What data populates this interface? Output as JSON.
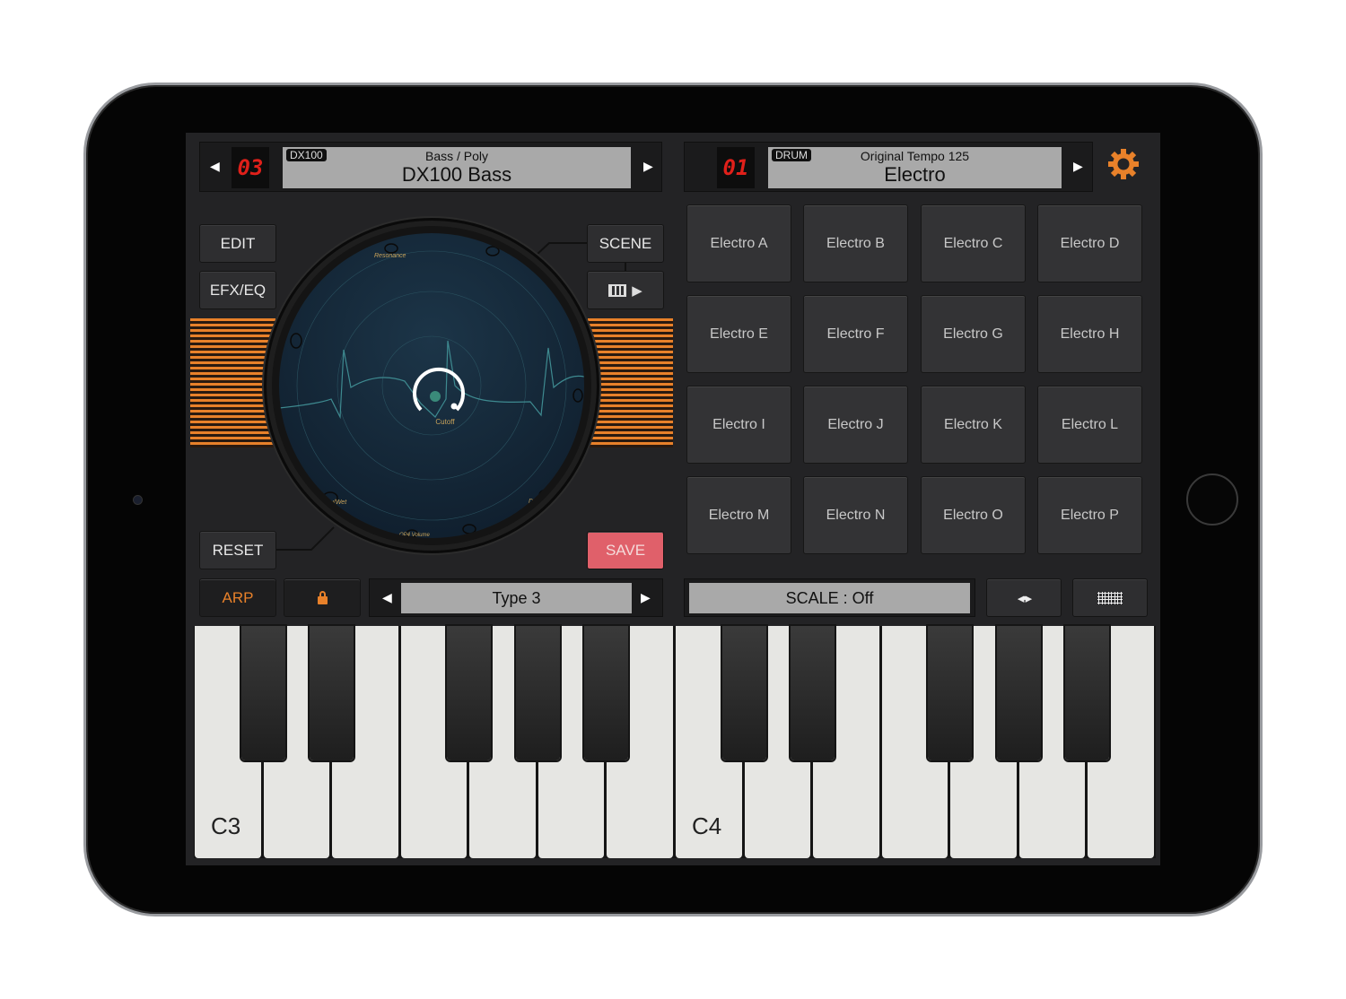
{
  "synth_header": {
    "program_number": "03",
    "tag": "DX100",
    "category": "Bass / Poly",
    "patch_name": "DX100 Bass",
    "prev_icon": "triangle-left",
    "next_icon": "triangle-right"
  },
  "drum_header": {
    "program_number": "01",
    "tag": "DRUM",
    "subtitle": "Original Tempo 125",
    "kit_name": "Electro",
    "next_icon": "triangle-right"
  },
  "settings_icon": "gear-icon",
  "buttons": {
    "edit": "EDIT",
    "efx_eq": "EFX/EQ",
    "scene": "SCENE",
    "reset": "RESET",
    "save": "SAVE",
    "arp": "ARP"
  },
  "knob_pad": {
    "center_label": "Cutoff",
    "labels": {
      "top": "Resonance",
      "bottom_left": "Dry/Wet",
      "bottom_right": "Dry/Wet",
      "bottom": "OP4 Volume"
    }
  },
  "arp_type": {
    "value": "Type 3"
  },
  "scale": {
    "value": "SCALE : Off"
  },
  "pads": [
    "Electro A",
    "Electro B",
    "Electro C",
    "Electro D",
    "Electro E",
    "Electro F",
    "Electro G",
    "Electro H",
    "Electro I",
    "Electro J",
    "Electro K",
    "Electro L",
    "Electro M",
    "Electro N",
    "Electro O",
    "Electro P"
  ],
  "keyboard": {
    "labels": [
      "C3",
      "C4"
    ]
  },
  "colors": {
    "accent": "#e8812a",
    "save": "#e0606a",
    "led": "#e0201a",
    "display": "#a9a9a9"
  }
}
